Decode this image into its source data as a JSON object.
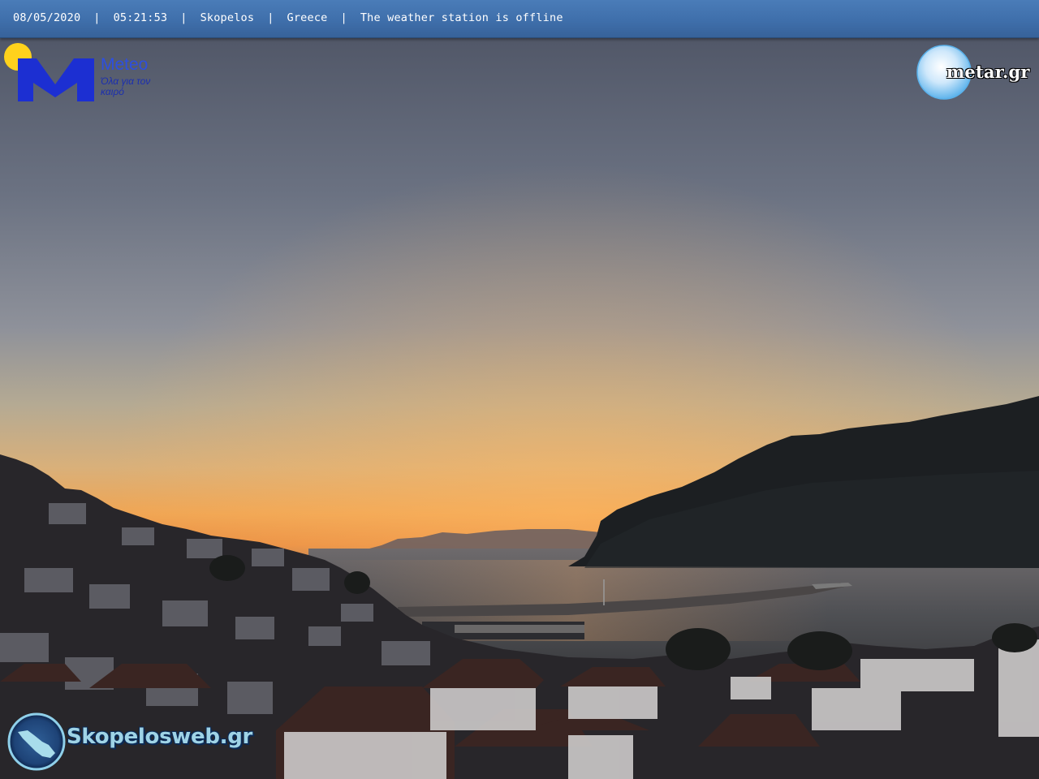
{
  "status_bar": {
    "date": "08/05/2020",
    "time": "05:21:53",
    "location": "Skopelos",
    "country": "Greece",
    "status": "The weather station is offline",
    "separator": "|"
  },
  "logos": {
    "meteo": {
      "brand": "Meteo",
      "tagline": "Όλα για τον καιρό",
      "color": "#1f3fd8"
    },
    "metar": {
      "text": "metar.gr"
    },
    "skopelosweb": {
      "text": "Skopelosweb.gr"
    }
  },
  "colors": {
    "bar": "#3f6fab",
    "sky_top": "#4c5264",
    "sky_horizon": "#f3a24d"
  }
}
